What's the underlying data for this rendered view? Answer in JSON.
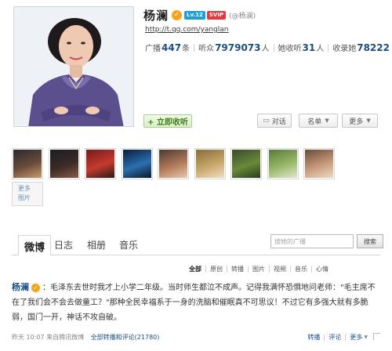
{
  "profile": {
    "name": "杨澜",
    "verified_icon": "verified-v-icon",
    "level_badge": "Lv.12",
    "vip_badge": "SVIP",
    "handle": "(@杨澜)",
    "url": "http://t.qq.com/yanglan",
    "stats": [
      {
        "label": "广播",
        "value": "447",
        "unit": "条"
      },
      {
        "label": "听众",
        "value": "7979073",
        "unit": "人"
      },
      {
        "label": "她收听",
        "value": "31",
        "unit": "人"
      },
      {
        "label": "收录她",
        "value": "78222",
        "unit": ""
      }
    ],
    "listen_button": "+ 立即收听",
    "dialog_button": "对话",
    "namelist_button": "名单",
    "more_button": "更多"
  },
  "gallery": {
    "more_label_line1": "更多",
    "more_label_line2": "图片",
    "thumbs": [
      {
        "name": "photo-thumb-1",
        "colors": [
          "#2a2a30",
          "#6b4b3a",
          "#c79a6a"
        ]
      },
      {
        "name": "photo-thumb-2",
        "colors": [
          "#1c1c26",
          "#3a2b26",
          "#8a5a48"
        ]
      },
      {
        "name": "photo-thumb-3",
        "colors": [
          "#7a1a1a",
          "#c43b2f",
          "#2b1a16"
        ]
      },
      {
        "name": "photo-thumb-4",
        "colors": [
          "#0a1c3a",
          "#2a6fb0",
          "#0c1628"
        ]
      },
      {
        "name": "photo-thumb-5",
        "colors": [
          "#4a3a30",
          "#b07a5a",
          "#e8c9a8"
        ]
      },
      {
        "name": "photo-thumb-6",
        "colors": [
          "#8a6a3a",
          "#c9a66a",
          "#f0dfc0"
        ]
      },
      {
        "name": "photo-thumb-7",
        "colors": [
          "#3a4a2a",
          "#6a8a3a",
          "#2a3a1a"
        ]
      },
      {
        "name": "photo-thumb-8",
        "colors": [
          "#5a7a3a",
          "#9ab868",
          "#dfe7cf"
        ]
      },
      {
        "name": "photo-thumb-9",
        "colors": [
          "#6a4a3a",
          "#c79a7a",
          "#efd9c6"
        ]
      }
    ]
  },
  "tabs": {
    "items": [
      "微博",
      "日志",
      "相册",
      "音乐"
    ],
    "active_index": 0,
    "search_placeholder": "搜她的广播",
    "search_button": "搜索"
  },
  "filters": {
    "items": [
      "全部",
      "原创",
      "转播",
      "图片",
      "视频",
      "音乐",
      "心情"
    ],
    "active_index": 0
  },
  "post": {
    "author": "杨澜",
    "text": "：毛泽东去世时我才上小学二年级。当时师生都泣不成声。记得我满怀恐惧地问老师：\"毛主席不在了我们会不会去做童工？\"那种全民幸福系于一身的洗脑和催眠真不可思议！不过它有多强大就有多脆弱，国门一开，神话不攻自破。",
    "time_source": "昨天 10:07 来自腾讯微博",
    "comment_count_label": "全部转播和评论(21780)",
    "action_repost": "转播",
    "action_comment": "评论",
    "action_more": "更多"
  }
}
